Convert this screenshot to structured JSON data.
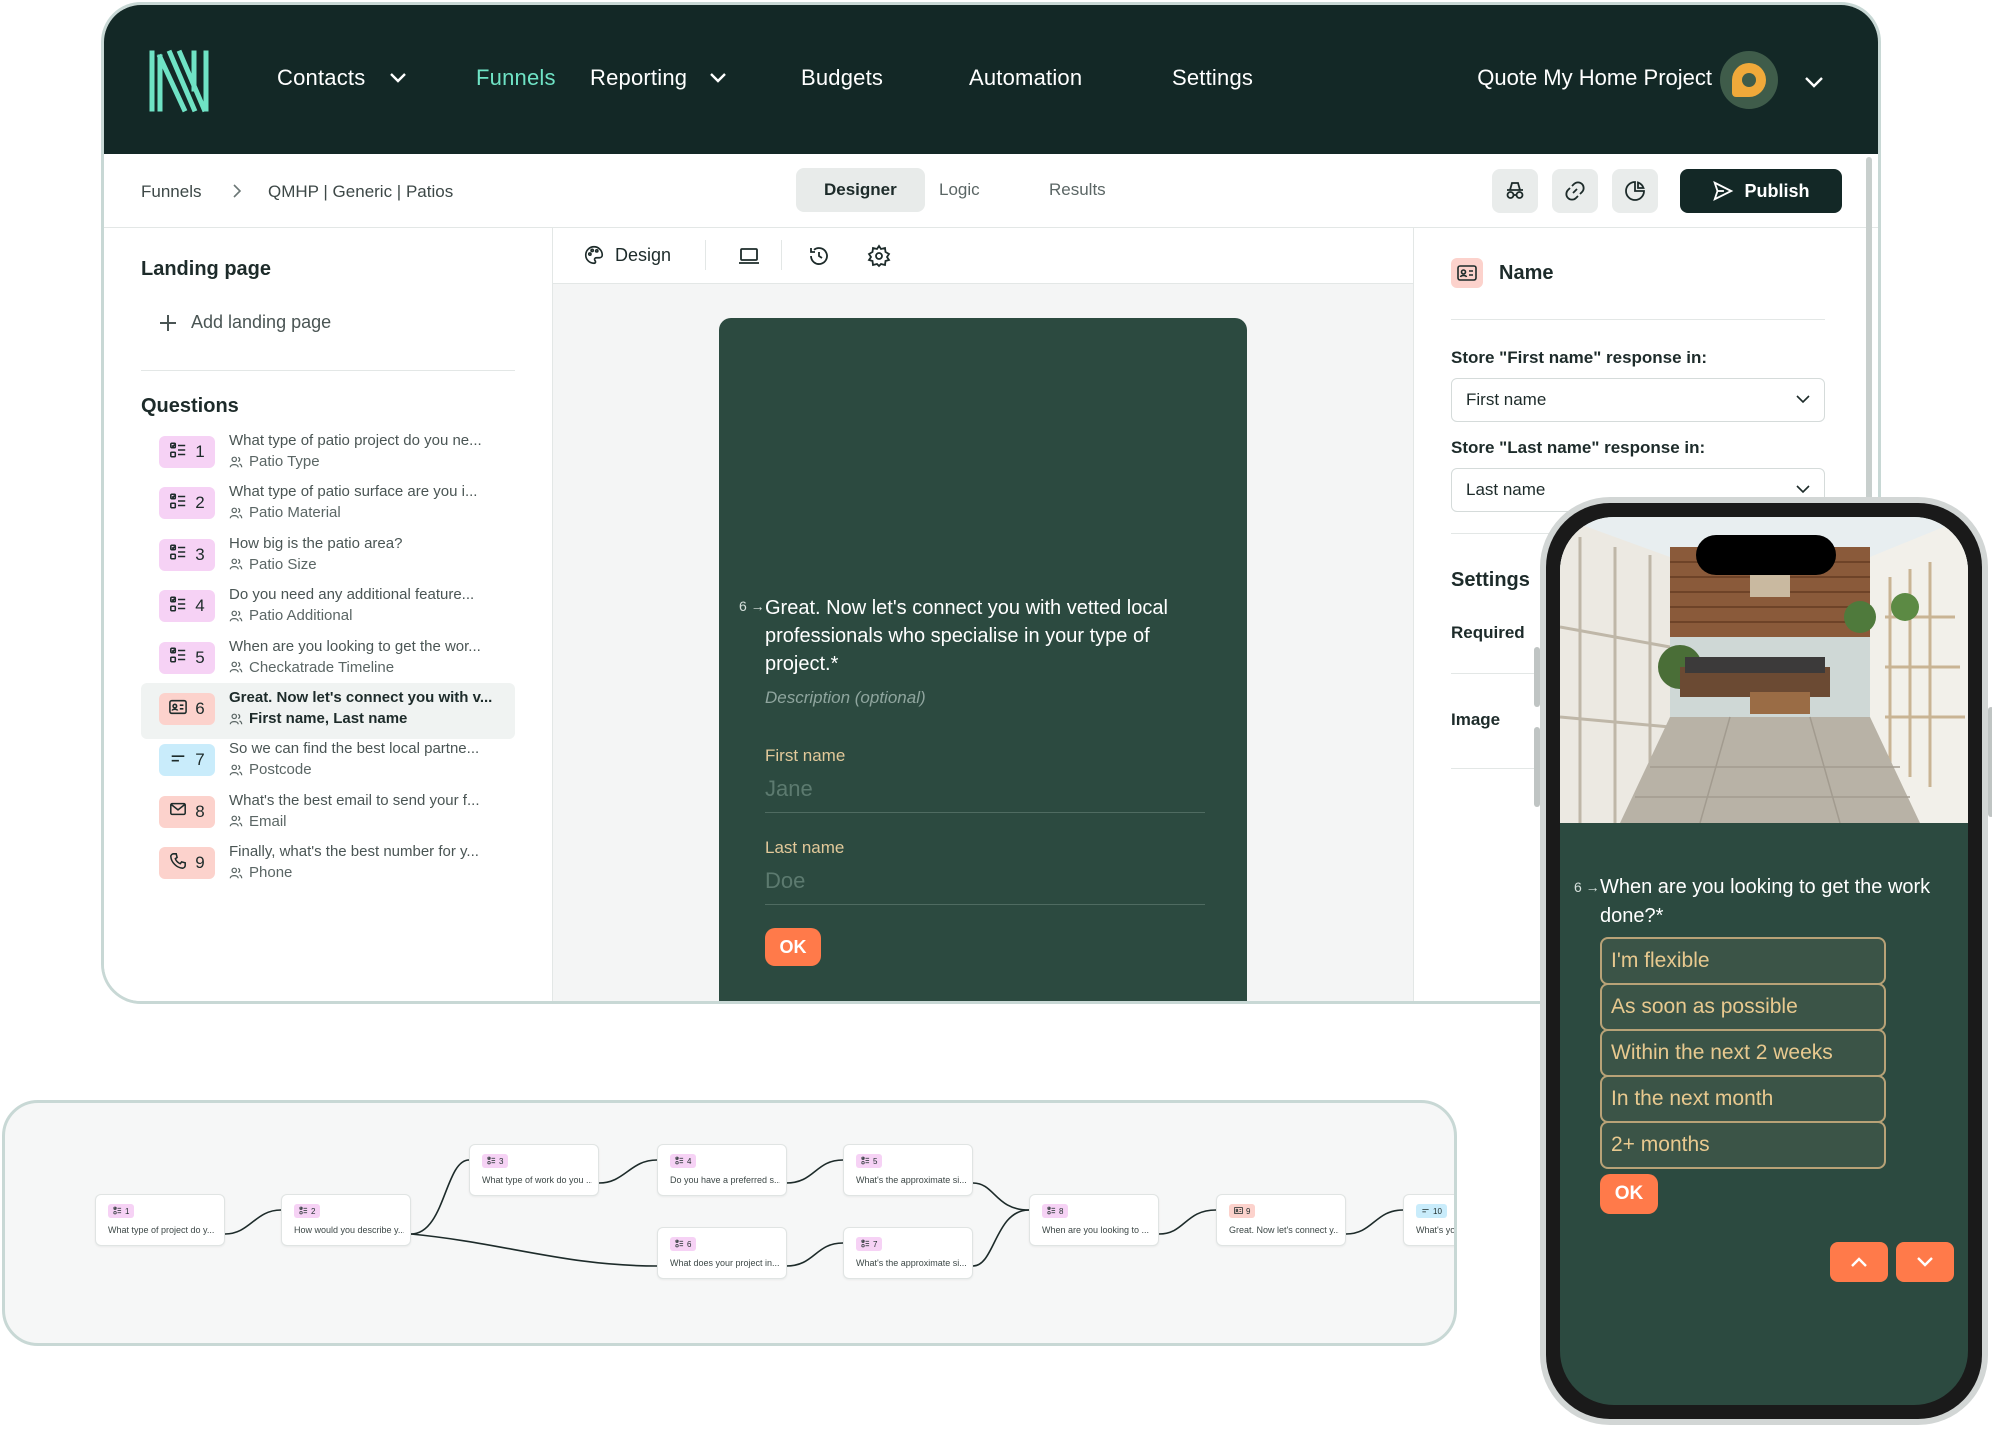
{
  "nav": {
    "items": [
      {
        "label": "Contacts",
        "dropdown": true
      },
      {
        "label": "Funnels",
        "active": true
      },
      {
        "label": "Reporting",
        "dropdown": true
      },
      {
        "label": "Budgets"
      },
      {
        "label": "Automation"
      },
      {
        "label": "Settings"
      }
    ],
    "account_name": "Quote My Home Project",
    "accent_color": "#6fe3c5",
    "background_color": "#132826"
  },
  "breadcrumb": {
    "root": "Funnels",
    "current": "QMHP | Generic | Patios"
  },
  "tabs": [
    {
      "label": "Designer",
      "active": true
    },
    {
      "label": "Logic"
    },
    {
      "label": "Results"
    }
  ],
  "toolbar": {
    "icons": [
      "incognito-icon",
      "link-icon",
      "analytics-icon"
    ],
    "publish_label": "Publish"
  },
  "sidebar": {
    "landing_heading": "Landing page",
    "add_landing_label": "Add landing page",
    "questions_heading": "Questions",
    "questions": [
      {
        "num": "1",
        "title": "What type of patio project do you ne...",
        "field": "Patio Type",
        "icon": "multiple-choice-icon",
        "color": "#f6d2f5"
      },
      {
        "num": "2",
        "title": "What type of patio surface are you i...",
        "field": "Patio Material",
        "icon": "multiple-choice-icon",
        "color": "#f6d2f5"
      },
      {
        "num": "3",
        "title": "How big is the patio area?",
        "field": "Patio Size",
        "icon": "multiple-choice-icon",
        "color": "#f6d2f5"
      },
      {
        "num": "4",
        "title": "Do you need any additional feature...",
        "field": "Patio Additional",
        "icon": "multiple-choice-icon",
        "color": "#f6d2f5"
      },
      {
        "num": "5",
        "title": "When are you looking to get the wor...",
        "field": "Checkatrade Timeline",
        "icon": "multiple-choice-icon",
        "color": "#f6d2f5"
      },
      {
        "num": "6",
        "title": "Great. Now let's connect you with v...",
        "field": "First name, Last name",
        "icon": "contact-card-icon",
        "color": "#fcd2cc",
        "selected": true
      },
      {
        "num": "7",
        "title": "So we can find the best local partne...",
        "field": "Postcode",
        "icon": "short-text-icon",
        "color": "#c9ecfb"
      },
      {
        "num": "8",
        "title": "What's the best email to send your f...",
        "field": "Email",
        "icon": "email-icon",
        "color": "#fcd2cc"
      },
      {
        "num": "9",
        "title": "Finally, what's the best number for y...",
        "field": "Phone",
        "icon": "phone-icon",
        "color": "#fcd2cc"
      }
    ]
  },
  "center": {
    "design_label": "Design",
    "form": {
      "question_number": "6 →",
      "question": "Great. Now let's connect you with vetted local professionals who specialise in your type of project.*",
      "description_placeholder": "Description (optional)",
      "first_name_label": "First name",
      "first_name_placeholder": "Jane",
      "last_name_label": "Last name",
      "last_name_placeholder": "Doe",
      "ok_label": "OK",
      "card_color": "#2c4a40",
      "button_color": "#ff7a4a"
    }
  },
  "right_panel": {
    "title": "Name",
    "first_label": "Store \"First name\" response in:",
    "first_value": "First name",
    "last_label": "Store \"Last name\" response in:",
    "last_value": "Last name",
    "settings_heading": "Settings",
    "required_label": "Required",
    "image_label": "Image"
  },
  "flow": {
    "nodes": [
      {
        "num": "1",
        "text": "What type of project do y...",
        "icon": "multiple-choice-icon",
        "color": "#f6d2f5"
      },
      {
        "num": "2",
        "text": "How would you describe y...",
        "icon": "multiple-choice-icon",
        "color": "#f6d2f5"
      },
      {
        "num": "3",
        "text": "What type of work do you ...",
        "icon": "multiple-choice-icon",
        "color": "#f6d2f5"
      },
      {
        "num": "4",
        "text": "Do you have a preferred s...",
        "icon": "multiple-choice-icon",
        "color": "#f6d2f5"
      },
      {
        "num": "5",
        "text": "What's the approximate si...",
        "icon": "multiple-choice-icon",
        "color": "#f6d2f5"
      },
      {
        "num": "6",
        "text": "What does your project in...",
        "icon": "multiple-choice-icon",
        "color": "#f6d2f5"
      },
      {
        "num": "7",
        "text": "What's the approximate si...",
        "icon": "multiple-choice-icon",
        "color": "#f6d2f5"
      },
      {
        "num": "8",
        "text": "When are you looking to ...",
        "icon": "multiple-choice-icon",
        "color": "#f6d2f5"
      },
      {
        "num": "9",
        "text": "Great. Now let's connect y...",
        "icon": "contact-card-icon",
        "color": "#fcd2cc"
      },
      {
        "num": "10",
        "text": "What's you",
        "icon": "short-text-icon",
        "color": "#c9ecfb"
      }
    ]
  },
  "phone": {
    "question_number": "6 →",
    "question": "When are you looking to get the work done?*",
    "choices": [
      "I'm flexible",
      "As soon as possible",
      "Within the next 2 weeks",
      "In the next month",
      "2+ months"
    ],
    "ok_label": "OK",
    "choice_border_color": "#b8a277",
    "choice_text_color": "#e8c98f"
  }
}
